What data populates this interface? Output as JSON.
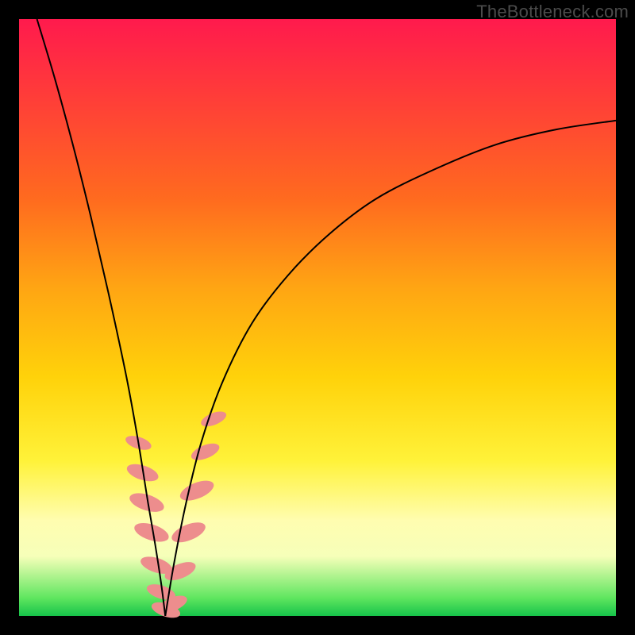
{
  "watermark": "TheBottleneck.com",
  "colors": {
    "gradient_top": "#ff1a4d",
    "gradient_mid1": "#ff6a1f",
    "gradient_mid2": "#ffd20a",
    "gradient_mid3": "#fffdb0",
    "gradient_bottom": "#16c34a",
    "curve": "#000000",
    "marker": "#ed8d8d",
    "frame": "#000000"
  },
  "chart_data": {
    "type": "line",
    "title": "",
    "xlabel": "",
    "ylabel": "",
    "xlim": [
      0,
      1
    ],
    "ylim": [
      0,
      1
    ],
    "note": "Bottleneck-style V-curve. y ≈ 1 at edges, dips to 0 at x ≈ 0.245; right branch asymptotes near y ≈ 0.83.",
    "series": [
      {
        "name": "left-branch",
        "x": [
          0.03,
          0.06,
          0.09,
          0.12,
          0.15,
          0.18,
          0.2,
          0.216,
          0.228,
          0.238,
          0.245
        ],
        "values": [
          1.0,
          0.9,
          0.79,
          0.67,
          0.54,
          0.4,
          0.29,
          0.19,
          0.12,
          0.055,
          0.0
        ]
      },
      {
        "name": "right-branch",
        "x": [
          0.245,
          0.26,
          0.28,
          0.305,
          0.34,
          0.39,
          0.45,
          0.52,
          0.6,
          0.7,
          0.8,
          0.9,
          1.0
        ],
        "values": [
          0.0,
          0.09,
          0.19,
          0.29,
          0.39,
          0.49,
          0.57,
          0.64,
          0.7,
          0.75,
          0.79,
          0.815,
          0.83
        ]
      }
    ],
    "markers": [
      {
        "branch": "left",
        "x": 0.2,
        "y": 0.29,
        "size": 0.018
      },
      {
        "branch": "left",
        "x": 0.207,
        "y": 0.24,
        "size": 0.022
      },
      {
        "branch": "left",
        "x": 0.214,
        "y": 0.19,
        "size": 0.024
      },
      {
        "branch": "left",
        "x": 0.222,
        "y": 0.14,
        "size": 0.024
      },
      {
        "branch": "left",
        "x": 0.23,
        "y": 0.085,
        "size": 0.022
      },
      {
        "branch": "left",
        "x": 0.238,
        "y": 0.04,
        "size": 0.02
      },
      {
        "branch": "left",
        "x": 0.246,
        "y": 0.01,
        "size": 0.02
      },
      {
        "branch": "right",
        "x": 0.258,
        "y": 0.02,
        "size": 0.02
      },
      {
        "branch": "right",
        "x": 0.27,
        "y": 0.075,
        "size": 0.022
      },
      {
        "branch": "right",
        "x": 0.284,
        "y": 0.14,
        "size": 0.024
      },
      {
        "branch": "right",
        "x": 0.298,
        "y": 0.21,
        "size": 0.024
      },
      {
        "branch": "right",
        "x": 0.312,
        "y": 0.275,
        "size": 0.02
      },
      {
        "branch": "right",
        "x": 0.326,
        "y": 0.33,
        "size": 0.018
      }
    ]
  }
}
